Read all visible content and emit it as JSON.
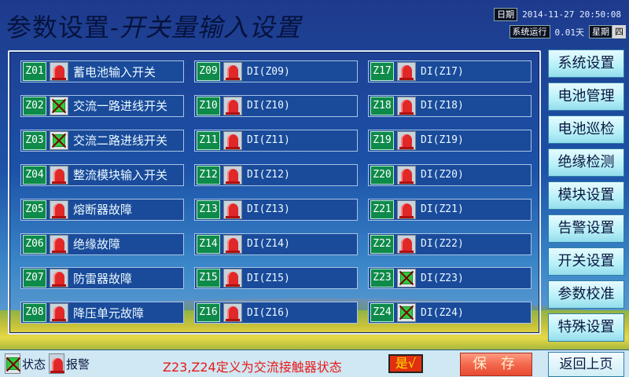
{
  "header": {
    "title_main": "参数设置",
    "title_sub": "-开关量输入设置",
    "date_label": "日期",
    "date_value": "2014-11-27 20:50:08",
    "uptime_label": "系统运行",
    "uptime_value": "0.01天",
    "weekday_label": "星期",
    "weekday_value": "四"
  },
  "inputs": [
    {
      "code": "Z01",
      "state": "alarm",
      "name": "蓄电池输入开关"
    },
    {
      "code": "Z02",
      "state": "status",
      "name": "交流一路进线开关"
    },
    {
      "code": "Z03",
      "state": "status",
      "name": "交流二路进线开关"
    },
    {
      "code": "Z04",
      "state": "alarm",
      "name": "整流模块输入开关"
    },
    {
      "code": "Z05",
      "state": "alarm",
      "name": "熔断器故障"
    },
    {
      "code": "Z06",
      "state": "alarm",
      "name": "绝缘故障"
    },
    {
      "code": "Z07",
      "state": "alarm",
      "name": "防雷器故障"
    },
    {
      "code": "Z08",
      "state": "alarm",
      "name": "降压单元故障"
    },
    {
      "code": "Z09",
      "state": "alarm",
      "name": "DI(Z09)"
    },
    {
      "code": "Z10",
      "state": "alarm",
      "name": "DI(Z10)"
    },
    {
      "code": "Z11",
      "state": "alarm",
      "name": "DI(Z11)"
    },
    {
      "code": "Z12",
      "state": "alarm",
      "name": "DI(Z12)"
    },
    {
      "code": "Z13",
      "state": "alarm",
      "name": "DI(Z13)"
    },
    {
      "code": "Z14",
      "state": "alarm",
      "name": "DI(Z14)"
    },
    {
      "code": "Z15",
      "state": "alarm",
      "name": "DI(Z15)"
    },
    {
      "code": "Z16",
      "state": "alarm",
      "name": "DI(Z16)"
    },
    {
      "code": "Z17",
      "state": "alarm",
      "name": "DI(Z17)"
    },
    {
      "code": "Z18",
      "state": "alarm",
      "name": "DI(Z18)"
    },
    {
      "code": "Z19",
      "state": "alarm",
      "name": "DI(Z19)"
    },
    {
      "code": "Z20",
      "state": "alarm",
      "name": "DI(Z20)"
    },
    {
      "code": "Z21",
      "state": "alarm",
      "name": "DI(Z21)"
    },
    {
      "code": "Z22",
      "state": "alarm",
      "name": "DI(Z22)"
    },
    {
      "code": "Z23",
      "state": "status",
      "name": "DI(Z23)"
    },
    {
      "code": "Z24",
      "state": "status",
      "name": "DI(Z24)"
    }
  ],
  "menu": [
    {
      "label": "系统设置"
    },
    {
      "label": "电池管理"
    },
    {
      "label": "电池巡检"
    },
    {
      "label": "绝缘检测"
    },
    {
      "label": "模块设置"
    },
    {
      "label": "告警设置"
    },
    {
      "label": "开关设置"
    },
    {
      "label": "参数校准"
    },
    {
      "label": "特殊设置"
    }
  ],
  "footer": {
    "legend_status": "状态",
    "legend_alarm": "报警",
    "note": "Z23,Z24定义为交流接触器状态",
    "yes_label": "是√",
    "save_label": "保 存",
    "back_label": "返回上页"
  },
  "colors": {
    "code_bg": "#0e8a4a",
    "alarm_bell": "#e02828",
    "status_green": "#2ecc40",
    "note_red": "#e81818"
  }
}
